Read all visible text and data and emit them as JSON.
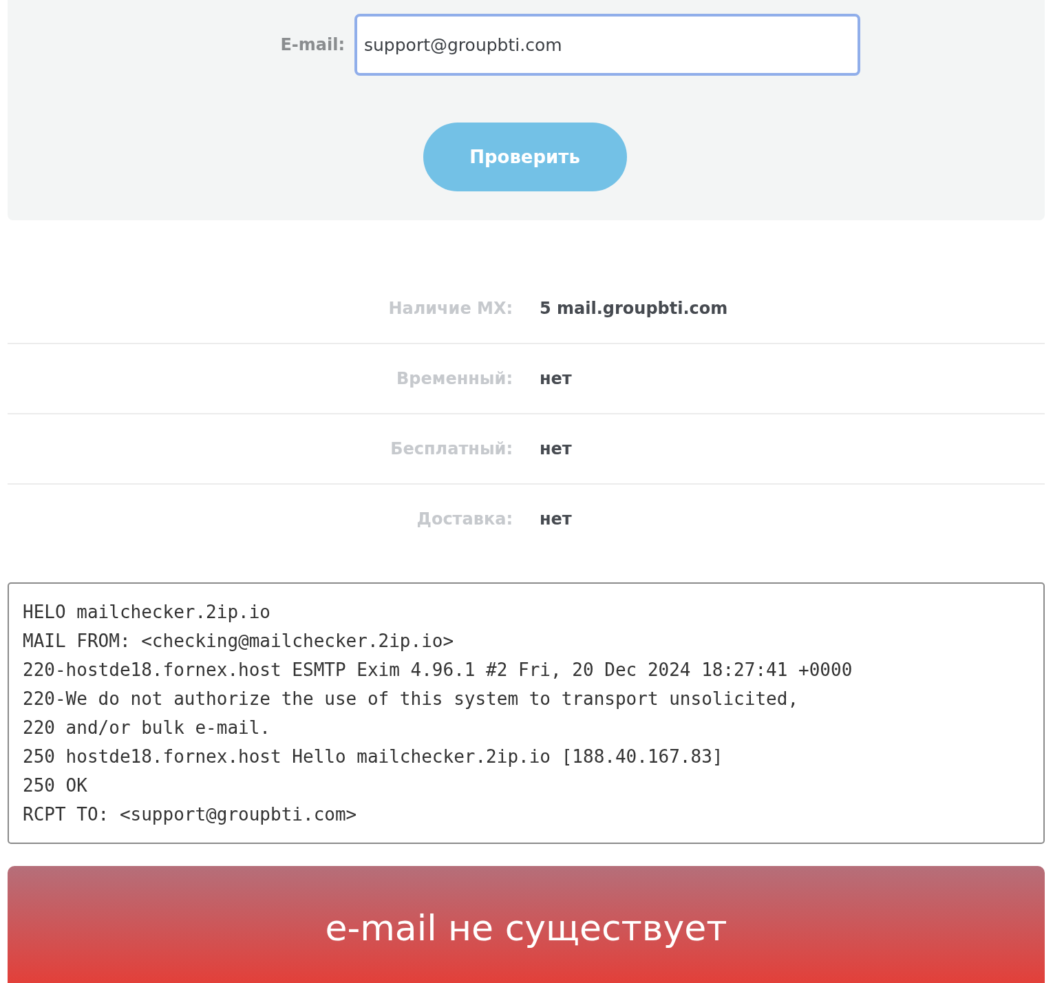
{
  "form": {
    "email_label": "E-mail:",
    "email_value": "support@groupbti.com",
    "submit_button": "Проверить"
  },
  "results": [
    {
      "label": "Наличие MX:",
      "value": "5 mail.groupbti.com"
    },
    {
      "label": "Временный:",
      "value": "нет"
    },
    {
      "label": "Бесплатный:",
      "value": "нет"
    },
    {
      "label": "Доставка:",
      "value": "нет"
    }
  ],
  "smtp_log": [
    "HELO mailchecker.2ip.io",
    "MAIL FROM: <checking@mailchecker.2ip.io>",
    "220-hostde18.fornex.host ESMTP Exim 4.96.1 #2 Fri, 20 Dec 2024 18:27:41 +0000",
    "220-We do not authorize the use of this system to transport unsolicited,",
    "220 and/or bulk e-mail.",
    "250 hostde18.fornex.host Hello mailchecker.2ip.io [188.40.167.83]",
    "250 OK",
    "RCPT TO: <support@groupbti.com>"
  ],
  "verdict": "e-mail не существует"
}
